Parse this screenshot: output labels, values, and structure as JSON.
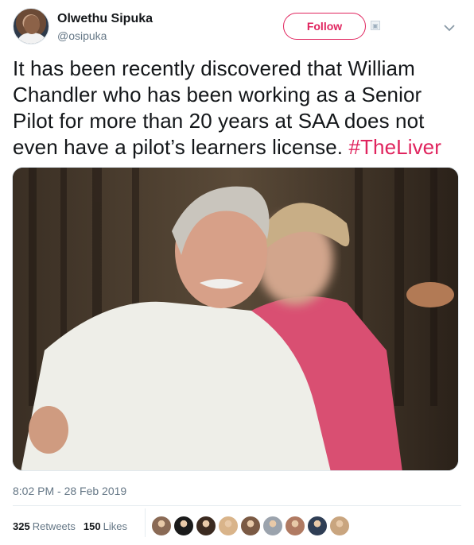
{
  "user": {
    "display_name": "Olwethu Sipuka",
    "handle": "@osipuka",
    "follow_label": "Follow"
  },
  "tweet": {
    "text": "It has been recently discovered that William Chandler who has been working as a Senior Pilot for more than 20 years at SAA does not even have a pilot’s learners license.",
    "hashtag": "#TheLiver",
    "timestamp": "8:02 PM - 28 Feb 2019"
  },
  "stats": {
    "retweets_count": "325",
    "retweets_label": "Retweets",
    "likes_count": "150",
    "likes_label": "Likes"
  },
  "liker_avatars": [
    {
      "icon": "avatar-photo",
      "color": "#8a6a55"
    },
    {
      "icon": "avatar-logo-curt",
      "color": "#1a1a1a"
    },
    {
      "icon": "avatar-photo",
      "color": "#3b2a20"
    },
    {
      "icon": "avatar-photo",
      "color": "#d9b48a"
    },
    {
      "icon": "avatar-photo",
      "color": "#7b5a44"
    },
    {
      "icon": "avatar-photo",
      "color": "#9ba3ad"
    },
    {
      "icon": "avatar-photo",
      "color": "#b07a62"
    },
    {
      "icon": "avatar-photo",
      "color": "#2f3e55"
    },
    {
      "icon": "avatar-photo",
      "color": "#c9a57f"
    }
  ],
  "colors": {
    "accent": "#e0245e",
    "secondary_text": "#657786"
  }
}
